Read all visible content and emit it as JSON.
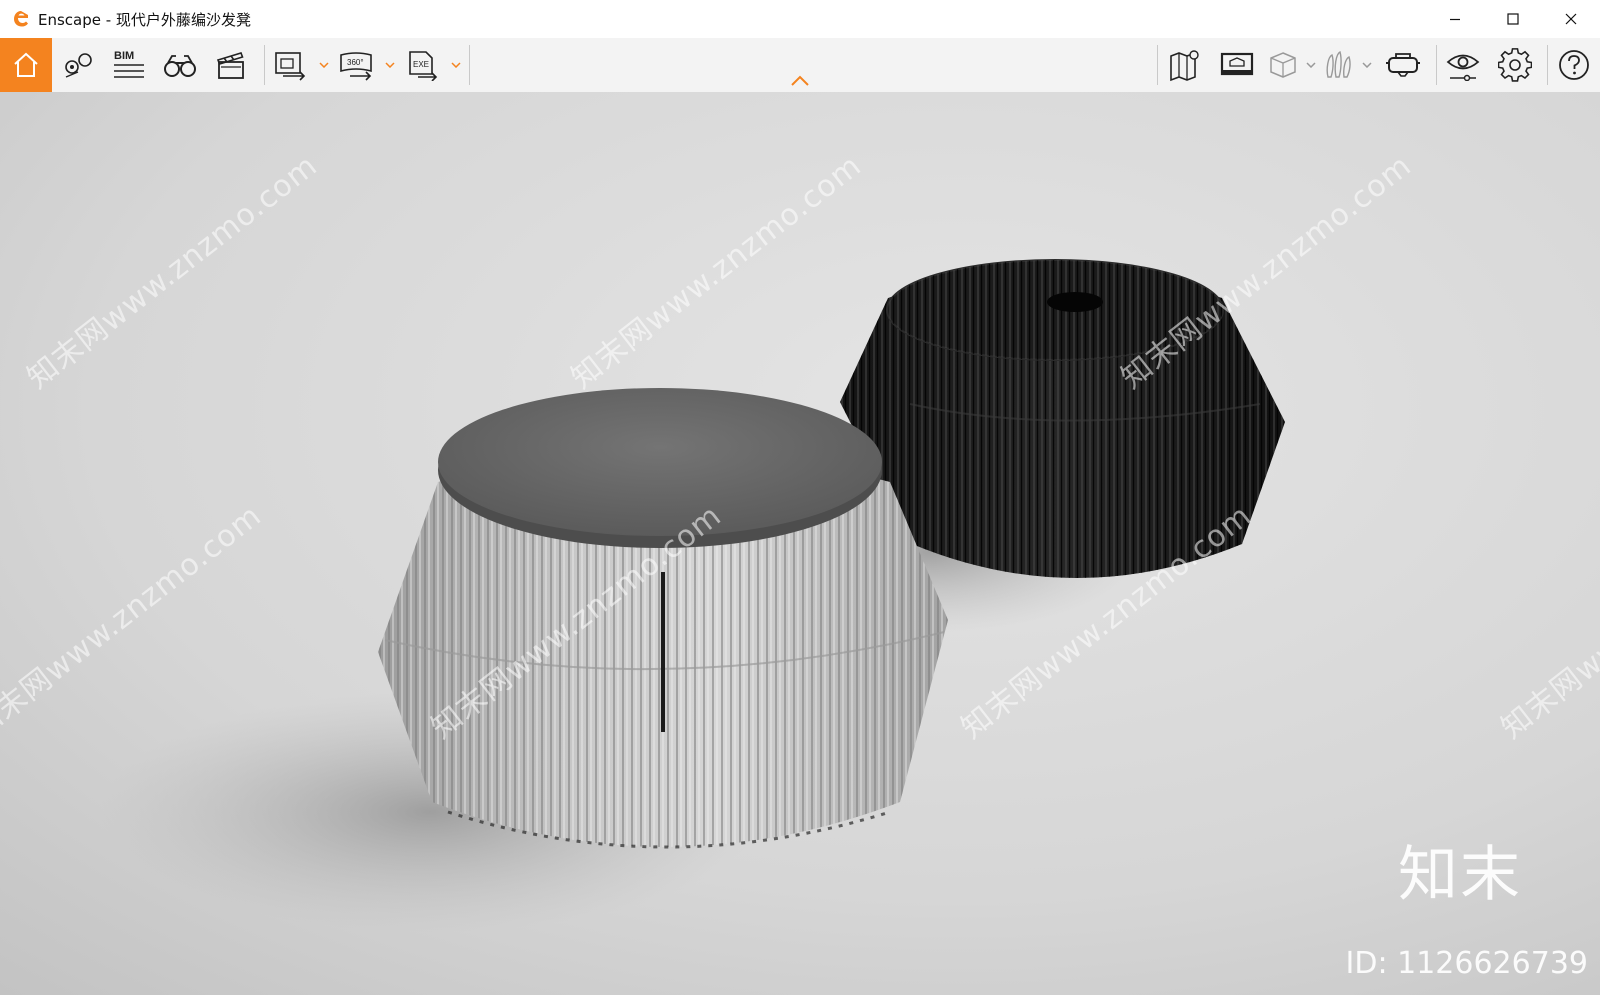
{
  "window": {
    "title": "Enscape - 现代户外藤编沙发凳",
    "controls": [
      "minimize",
      "maximize",
      "close"
    ]
  },
  "toolbar": {
    "left_buttons": [
      {
        "name": "home",
        "icon": "home-icon",
        "active": true
      },
      {
        "name": "views",
        "icon": "map-pin-icon"
      },
      {
        "name": "bim",
        "icon": "bim-icon",
        "label": "BIM"
      },
      {
        "name": "binoculars",
        "icon": "binoculars-icon"
      },
      {
        "name": "video",
        "icon": "clapperboard-icon"
      },
      {
        "name": "export-image",
        "icon": "image-export-icon",
        "has_dropdown": true
      },
      {
        "name": "export-panorama",
        "icon": "panorama-360-icon",
        "label": "360°",
        "has_dropdown": true
      },
      {
        "name": "export-exe",
        "icon": "exe-export-icon",
        "label": "EXE",
        "has_dropdown": true
      }
    ],
    "right_buttons": [
      {
        "name": "map",
        "icon": "map-icon"
      },
      {
        "name": "atlas",
        "icon": "monitor-icon"
      },
      {
        "name": "cube",
        "icon": "cube-icon",
        "has_dropdown": true
      },
      {
        "name": "asset-library",
        "icon": "asset-library-icon",
        "has_dropdown": true
      },
      {
        "name": "vr",
        "icon": "vr-headset-icon"
      },
      {
        "name": "visual-settings",
        "icon": "eye-icon"
      },
      {
        "name": "settings",
        "icon": "gear-icon"
      },
      {
        "name": "help",
        "icon": "help-icon"
      }
    ],
    "accent_color": "#f4831f"
  },
  "viewport": {
    "watermark_text": "知末网www.znzmo.com",
    "brand_logo": "知末",
    "brand_id": "ID: 1126626739"
  }
}
